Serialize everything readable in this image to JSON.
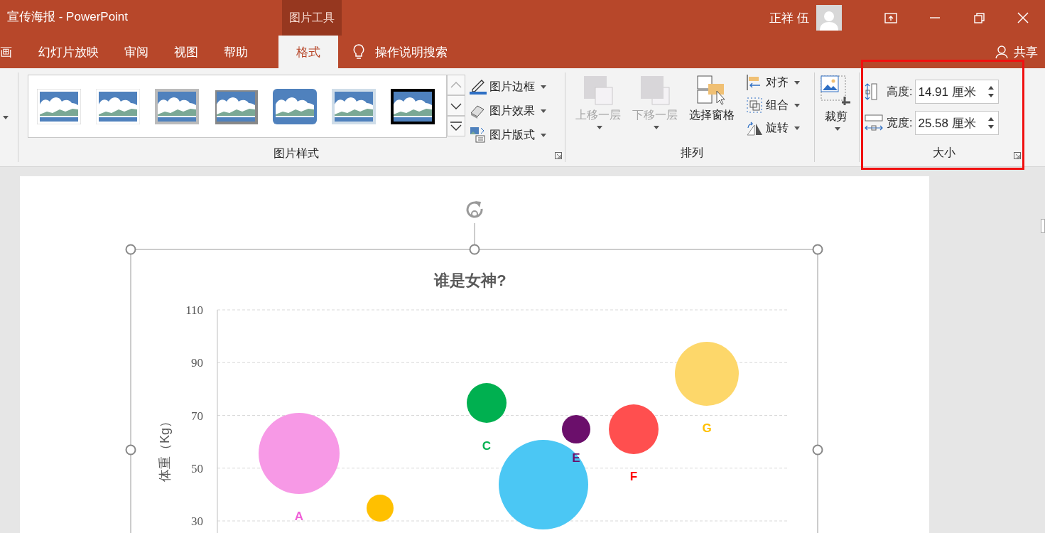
{
  "window": {
    "title": "宣传海报  -  PowerPoint",
    "context_tab": "图片工具",
    "user": "正祥 伍"
  },
  "tabs": [
    {
      "label": "画",
      "selected": false
    },
    {
      "label": "幻灯片放映",
      "selected": false
    },
    {
      "label": "审阅",
      "selected": false
    },
    {
      "label": "视图",
      "selected": false
    },
    {
      "label": "帮助",
      "selected": false
    },
    {
      "label": "格式",
      "selected": true
    }
  ],
  "tell_me": "操作说明搜索",
  "share": "共享",
  "ribbon": {
    "picture_styles": {
      "label": "图片样式",
      "commands": [
        {
          "label": "图片边框"
        },
        {
          "label": "图片效果"
        },
        {
          "label": "图片版式"
        }
      ]
    },
    "arrange": {
      "label": "排列",
      "large": [
        {
          "label": "上移一层",
          "disabled": true
        },
        {
          "label": "下移一层",
          "disabled": true
        },
        {
          "label": "选择窗格",
          "disabled": false
        }
      ],
      "small": [
        {
          "label": "对齐"
        },
        {
          "label": "组合"
        },
        {
          "label": "旋转"
        }
      ]
    },
    "crop": {
      "label": "裁剪"
    },
    "size": {
      "label": "大小",
      "highlighted": true,
      "fields": [
        {
          "label": "高度:",
          "value": "14.91 厘米"
        },
        {
          "label": "宽度:",
          "value": "25.58 厘米"
        }
      ]
    }
  },
  "slide": {
    "chart": {
      "title": "谁是女神?",
      "y_axis_title": "体重（Kg）",
      "y_tick_labels": [
        "110",
        "90",
        "70",
        "50",
        "30"
      ],
      "point_labels": [
        {
          "text": "A",
          "color": "#f060d8"
        },
        {
          "text": "C",
          "color": "#00b050"
        },
        {
          "text": "E",
          "color": "#6b0f6b"
        },
        {
          "text": "F",
          "color": "#ff0000"
        },
        {
          "text": "G",
          "color": "#ffc000"
        }
      ]
    }
  }
}
